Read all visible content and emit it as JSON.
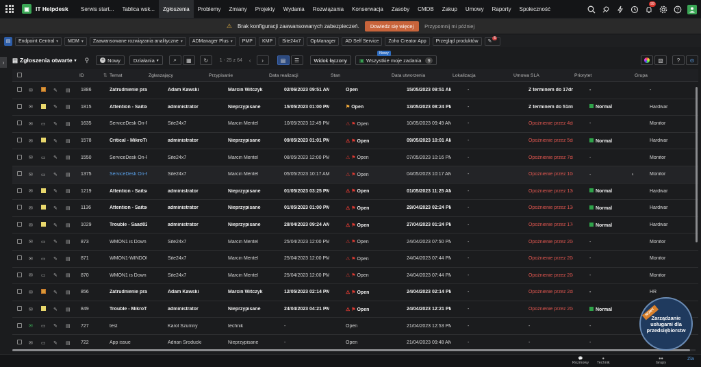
{
  "app": {
    "title": "IT Helpdesk",
    "logo_letter": "IT"
  },
  "nav": {
    "tabs": [
      "Serwis start...",
      "Tablica wsk...",
      "Zgłoszenia",
      "Problemy",
      "Zmiany",
      "Projekty",
      "Wydania",
      "Rozwiązania",
      "Konserwacja",
      "Zasoby",
      "CMDB",
      "Zakup",
      "Umowy",
      "Raporty",
      "Społeczność"
    ],
    "active_index": 2,
    "notif_count": "99"
  },
  "alert": {
    "message": "Brak konfiguracji zaawansowanych zabezpieczeń.",
    "learn": "Dowiedz się więcej",
    "remind": "Przypomnij mi później"
  },
  "tools": [
    "Endpoint Central",
    "MDM",
    "Zaawansowane rozwiązania analityczne",
    "ADManager Plus",
    "PMP",
    "KMP",
    "Site24x7",
    "OpManager",
    "AD Self Service",
    "Zoho Creator App",
    "Przegląd produktów"
  ],
  "tools_badge": "5",
  "listbar": {
    "title": "Zgłoszenia otwarte",
    "new_label": "Nowy",
    "actions_label": "Działania",
    "pager": "1 - 25 z 64",
    "view_label": "Widok łączony",
    "new_badge": "Nowy",
    "mytasks_label": "Wszystkie moje zadania",
    "mytasks_count": "9"
  },
  "columns": [
    "ID",
    "Temat",
    "Zgłaszający",
    "Przypisanie",
    "Data realizacji",
    "Stan",
    "Data utworzenia",
    "Lokalizacja",
    "Umowa SLA",
    "Priorytet",
    "Grupa"
  ],
  "rows": [
    {
      "id": "1886",
      "subject": "Zatrudnienie pracownik...",
      "requester": "Adam Kawski",
      "assign": "Marcin Witczyk",
      "due": "02/06/2023 09:51 AM",
      "status": "Open",
      "created": "15/05/2023 09:51 AM",
      "loc": "-",
      "sla": "Z terminem do 17dni 21...",
      "prio": "-",
      "group": "-",
      "bold": true,
      "alert": false,
      "flag": "none",
      "note": "orange",
      "sla_red": false,
      "prio_green": false
    },
    {
      "id": "1815",
      "subject": "Attention - Saitom01 W...",
      "requester": "administrator",
      "assign": "Nieprzypisane",
      "due": "15/05/2023 01:00 PM",
      "status": "Open",
      "created": "13/05/2023 08:24 PM",
      "loc": "-",
      "sla": "Z terminem do 51min",
      "prio": "Normal",
      "group": "Hardwar",
      "bold": true,
      "alert": false,
      "flag": "orange",
      "note": "yellow",
      "sla_red": false,
      "prio_green": true
    },
    {
      "id": "1635",
      "subject": "ServiceDesk On-Premis...",
      "requester": "Site24x7",
      "assign": "Marcin Mentel",
      "due": "10/05/2023 12:49 PM",
      "status": "Open",
      "created": "10/05/2023 09:49 AM",
      "loc": "-",
      "sla": "Opoźnienie przez 4dni 2...",
      "prio": "-",
      "group": "Monitor",
      "bold": false,
      "alert": true,
      "flag": "red",
      "note": "none",
      "sla_red": true,
      "prio_green": false
    },
    {
      "id": "1578",
      "subject": "Critical - MikroTik MiKr...",
      "requester": "administrator",
      "assign": "Nieprzypisane",
      "due": "09/05/2023 01:01 PM",
      "status": "Open",
      "created": "09/05/2023 10:01 AM",
      "loc": "-",
      "sla": "Opoźnienie przez 5dni 2...",
      "prio": "Normal",
      "group": "Hardwar",
      "bold": true,
      "alert": true,
      "flag": "red",
      "note": "yellow",
      "sla_red": true,
      "prio_green": true
    },
    {
      "id": "1550",
      "subject": "ServiceDesk On-Premis...",
      "requester": "Site24x7",
      "assign": "Marcin Mentel",
      "due": "08/05/2023 12:00 PM",
      "status": "Open",
      "created": "07/05/2023 10:16 PM",
      "loc": "-",
      "sla": "Opoźnienie przez 7dni",
      "prio": "-",
      "group": "Monitor",
      "bold": false,
      "alert": true,
      "flag": "red",
      "note": "none",
      "sla_red": true,
      "prio_green": false
    },
    {
      "id": "1375",
      "subject": "ServiceDesk On-Premis...",
      "requester": "Site24x7",
      "assign": "Marcin Mentel",
      "due": "05/05/2023 10:17 AM",
      "status": "Open",
      "created": "04/05/2023 10:17 AM",
      "loc": "-",
      "sla": "Opoźnienie przez 10dni ...",
      "prio": "-",
      "group": "Monitor",
      "bold": false,
      "alert": true,
      "flag": "red",
      "note": "none",
      "sla_red": true,
      "prio_green": false,
      "link": true
    },
    {
      "id": "1219",
      "subject": "Attention - Saitsec02 W...",
      "requester": "administrator",
      "assign": "Nieprzypisane",
      "due": "01/05/2023 03:25 PM",
      "status": "Open",
      "created": "01/05/2023 11:25 AM",
      "loc": "-",
      "sla": "Opoźnienie przez 13dni ...",
      "prio": "Normal",
      "group": "Hardwar",
      "bold": true,
      "alert": true,
      "flag": "red",
      "note": "yellow",
      "sla_red": true,
      "prio_green": true
    },
    {
      "id": "1136",
      "subject": "Attention - Saitsec01 W...",
      "requester": "administrator",
      "assign": "Nieprzypisane",
      "due": "01/05/2023 01:00 PM",
      "status": "Open",
      "created": "29/04/2023 02:24 PM",
      "loc": "-",
      "sla": "Opoźnienie przez 13dni ...",
      "prio": "Normal",
      "group": "Hardwar",
      "bold": true,
      "alert": true,
      "flag": "red",
      "note": "yellow",
      "sla_red": true,
      "prio_green": true
    },
    {
      "id": "1029",
      "subject": "Trouble - Saad02 Wind...",
      "requester": "administrator",
      "assign": "Nieprzypisane",
      "due": "28/04/2023 09:24 AM",
      "status": "Open",
      "created": "27/04/2023 01:24 PM",
      "loc": "-",
      "sla": "Opoźnienie przez 17dni ...",
      "prio": "Normal",
      "group": "Hardwar",
      "bold": true,
      "alert": true,
      "flag": "red",
      "note": "yellow",
      "sla_red": true,
      "prio_green": true
    },
    {
      "id": "873",
      "subject": "WMON1 is Down",
      "requester": "Site24x7",
      "assign": "Marcin Mentel",
      "due": "25/04/2023 12:00 PM",
      "status": "Open",
      "created": "24/04/2023 07:50 PM",
      "loc": "-",
      "sla": "Opoźnienie przez 20dni",
      "prio": "-",
      "group": "Monitor",
      "bold": false,
      "alert": true,
      "flag": "red",
      "note": "none",
      "sla_red": true,
      "prio_green": false
    },
    {
      "id": "871",
      "subject": "WMON1-WINDOWS UP...",
      "requester": "Site24x7",
      "assign": "Marcin Mentel",
      "due": "25/04/2023 12:00 PM",
      "status": "Open",
      "created": "24/04/2023 07:44 PM",
      "loc": "-",
      "sla": "Opoźnienie przez 20dni",
      "prio": "-",
      "group": "Monitor",
      "bold": false,
      "alert": true,
      "flag": "red",
      "note": "none",
      "sla_red": true,
      "prio_green": false
    },
    {
      "id": "870",
      "subject": "WMON1 is Down",
      "requester": "Site24x7",
      "assign": "Marcin Mentel",
      "due": "25/04/2023 12:00 PM",
      "status": "Open",
      "created": "24/04/2023 07:44 PM",
      "loc": "-",
      "sla": "Opoźnienie przez 20dni",
      "prio": "-",
      "group": "Monitor",
      "bold": false,
      "alert": true,
      "flag": "red",
      "note": "none",
      "sla_red": true,
      "prio_green": false
    },
    {
      "id": "856",
      "subject": "Zatrudnienie pracownik...",
      "requester": "Adam Kawski",
      "assign": "Marcin Witczyk",
      "due": "12/05/2023 02:14 PM",
      "status": "Open",
      "created": "24/04/2023 02:14 PM",
      "loc": "-",
      "sla": "Opoźnienie przez 2dni 2...",
      "prio": "-",
      "group": "HR",
      "bold": true,
      "alert": true,
      "flag": "red",
      "note": "orange",
      "sla_red": true,
      "prio_green": false
    },
    {
      "id": "849",
      "subject": "Trouble - MikroTik MiKr...",
      "requester": "administrator",
      "assign": "Nieprzypisane",
      "due": "24/04/2023 04:21 PM",
      "status": "Open",
      "created": "24/04/2023 12:21 PM",
      "loc": "-",
      "sla": "Opoźnienie przez 20dni ...",
      "prio": "Normal",
      "group": "Hardwar",
      "bold": true,
      "alert": true,
      "flag": "red",
      "note": "yellow",
      "sla_red": true,
      "prio_green": true
    },
    {
      "id": "727",
      "subject": "test",
      "requester": "Karol Szumny",
      "assign": "technik",
      "due": "-",
      "status": "Open",
      "created": "21/04/2023 12:53 PM",
      "loc": "-",
      "sla": "-",
      "prio": "-",
      "group": "-",
      "bold": false,
      "alert": false,
      "flag": "none",
      "note": "none",
      "sla_red": false,
      "prio_green": false,
      "green_mail": true
    },
    {
      "id": "722",
      "subject": "App issue",
      "requester": "Adrian Sroducki",
      "assign": "Nieprzypisane",
      "due": "-",
      "status": "Open",
      "created": "21/04/2023 09:48 AM",
      "loc": "-",
      "sla": "-",
      "prio": "-",
      "group": "Hardwar",
      "bold": false,
      "alert": false,
      "flag": "none",
      "note": "none",
      "sla_red": false,
      "prio_green": false
    }
  ],
  "bottom": {
    "a": "Rozmowy",
    "b": "Technik",
    "c": "Grupy"
  },
  "promo": {
    "text": "Zarządzanie usługami dla przedsiębiorstw",
    "ribbon": "NOWY"
  },
  "colors": {
    "accent": "#3aa655",
    "alert_btn": "#c8643b",
    "red": "#e0564f",
    "green": "#2fa34a"
  }
}
